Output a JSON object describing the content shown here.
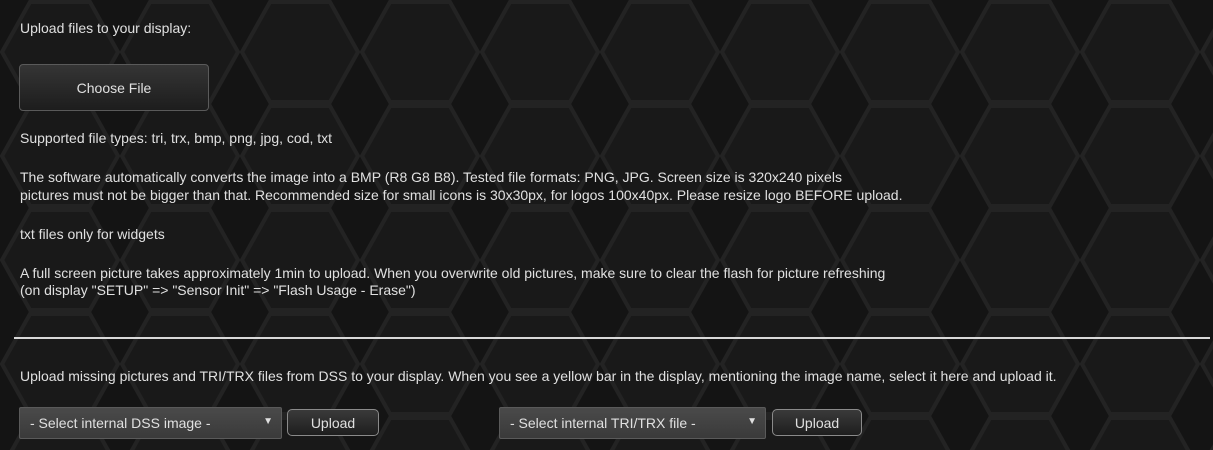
{
  "upload_section": {
    "title": "Upload files to your display:",
    "choose_file_label": "Choose File",
    "supported_types": "Supported file types: tri, trx, bmp, png, jpg, cod, txt",
    "description_line1": "The software automatically converts the image into a BMP (R8 G8 B8). Tested file formats: PNG, JPG. Screen size is 320x240 pixels",
    "description_line2": "pictures must not be bigger than that. Recommended size for small icons is 30x30px, for logos 100x40px. Please resize logo BEFORE upload.",
    "txt_note": "txt files only for widgets",
    "fullscreen_line1": "A full screen picture takes approximately 1min to upload. When you overwrite old pictures, make sure to clear the flash for picture refreshing",
    "fullscreen_line2": "(on display \"SETUP\" => \"Sensor Init\" => \"Flash Usage - Erase\")"
  },
  "dss_section": {
    "instructions": "Upload missing pictures and TRI/TRX files from DSS to your display. When you see a yellow bar in the display, mentioning the image name, select it here and upload it.",
    "image_select_value": "- Select internal DSS image -",
    "image_upload_label": "Upload",
    "trx_select_value": "- Select internal TRI/TRX file -",
    "trx_upload_label": "Upload",
    "dropdown_arrow": "▼"
  },
  "colors": {
    "background": "#141414",
    "hex_stroke": "#232323",
    "text": "#e0e0e0",
    "divider": "#d8d8d8"
  }
}
